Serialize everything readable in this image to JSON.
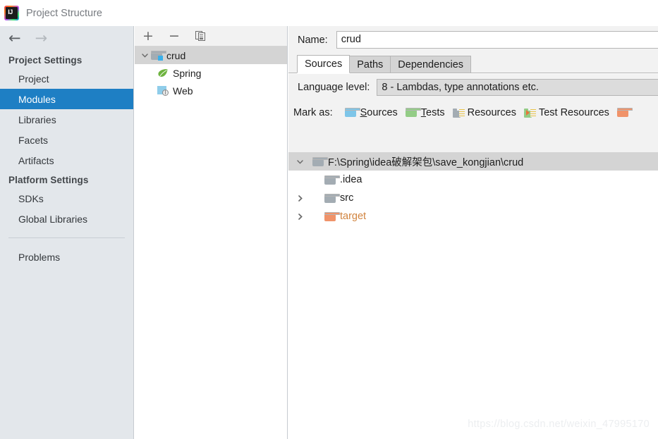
{
  "window": {
    "title": "Project Structure",
    "logo_icon": "intellij-idea-logo",
    "logo_text": "IJ"
  },
  "sidebar": {
    "back_icon": "arrow-left-icon",
    "forward_icon": "arrow-right-icon",
    "groups": [
      {
        "header": "Project Settings",
        "items": [
          {
            "label": "Project",
            "selected": false
          },
          {
            "label": "Modules",
            "selected": true
          },
          {
            "label": "Libraries",
            "selected": false
          },
          {
            "label": "Facets",
            "selected": false
          },
          {
            "label": "Artifacts",
            "selected": false
          }
        ]
      },
      {
        "header": "Platform Settings",
        "items": [
          {
            "label": "SDKs",
            "selected": false
          },
          {
            "label": "Global Libraries",
            "selected": false
          }
        ]
      }
    ],
    "problems_label": "Problems",
    "selected_color": "#1e7fc4",
    "background_color": "#e3e7eb"
  },
  "modules_panel": {
    "toolbar": {
      "add_label": "+",
      "remove_label": "−",
      "copy_icon": "copy-icon"
    },
    "tree": [
      {
        "label": "crud",
        "icon": "module-folder-icon",
        "level": 0,
        "expanded": true,
        "selected": true
      },
      {
        "label": "Spring",
        "icon": "spring-leaf-icon",
        "level": 1,
        "expanded": null,
        "selected": false
      },
      {
        "label": "Web",
        "icon": "web-globe-icon",
        "level": 1,
        "expanded": null,
        "selected": false
      }
    ]
  },
  "detail": {
    "name_label": "Name:",
    "name_value": "crud",
    "tabs": [
      {
        "label": "Sources",
        "active": true
      },
      {
        "label": "Paths",
        "active": false
      },
      {
        "label": "Dependencies",
        "active": false
      }
    ],
    "language_level_label": "Language level:",
    "language_level_value": "8 - Lambdas, type annotations etc.",
    "mark_as_label": "Mark as:",
    "mark_as_buttons": [
      {
        "label": "Sources",
        "mnemonic": "S",
        "icon": "sources-folder-icon"
      },
      {
        "label": "Tests",
        "mnemonic": "T",
        "icon": "tests-folder-icon"
      },
      {
        "label": "Resources",
        "mnemonic": "",
        "icon": "resources-folder-icon"
      },
      {
        "label": "Test Resources",
        "mnemonic": "",
        "icon": "test-resources-folder-icon"
      },
      {
        "label": "",
        "mnemonic": "",
        "icon": "excluded-folder-icon"
      }
    ],
    "file_tree": [
      {
        "label": "F:\\Spring\\idea破解架包\\save_kongjian\\crud",
        "icon": "folder-icon",
        "level": 0,
        "expanded": true,
        "selected": true,
        "excluded": false
      },
      {
        "label": ".idea",
        "icon": "folder-icon",
        "level": 1,
        "expanded": null,
        "selected": false,
        "excluded": false
      },
      {
        "label": "src",
        "icon": "folder-icon",
        "level": 1,
        "expanded": false,
        "selected": false,
        "excluded": false
      },
      {
        "label": "target",
        "icon": "excluded-folder-icon",
        "level": 1,
        "expanded": false,
        "selected": false,
        "excluded": true
      }
    ]
  },
  "watermark": {
    "text": "https://blog.csdn.net/weixin_47995170"
  }
}
